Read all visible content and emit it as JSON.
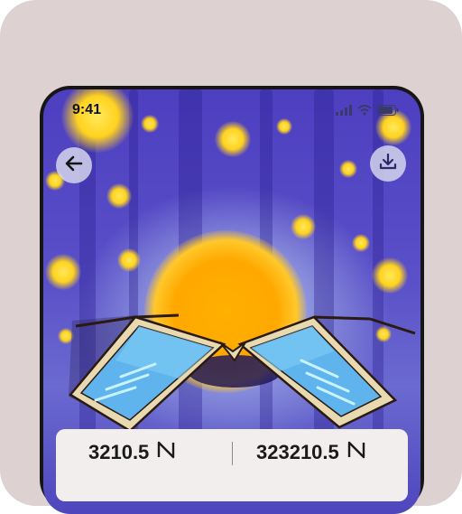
{
  "status_bar": {
    "time": "9:41"
  },
  "header": {
    "back_icon": "arrow-left-icon",
    "download_icon": "download-icon"
  },
  "stats": {
    "left_value": "3210.5",
    "right_value": "323210.5",
    "currency_icon": "near-token-icon"
  },
  "colors": {
    "page_background": "#ddd2d1",
    "sky": "#5a50c8",
    "sun": "#ffa800",
    "firefly": "#ffd21f",
    "panel": "#f3eeee"
  }
}
